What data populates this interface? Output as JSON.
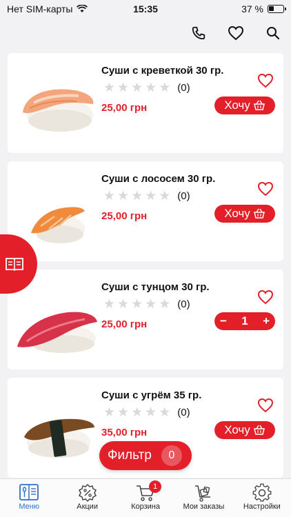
{
  "status_bar": {
    "carrier": "Нет SIM-карты",
    "time": "15:35",
    "battery_text": "37 %",
    "battery_level": 0.37
  },
  "header": {
    "icons": [
      "phone-icon",
      "heart-icon",
      "search-icon"
    ]
  },
  "products": [
    {
      "title": "Суши с креветкой 30 гр.",
      "rating_count": "(0)",
      "price": "25,00 грн",
      "button_label": "Хочу",
      "in_cart": false
    },
    {
      "title": "Суши с лососем 30 гр.",
      "rating_count": "(0)",
      "price": "25,00 грн",
      "button_label": "Хочу",
      "in_cart": false
    },
    {
      "title": "Суши с тунцом 30 гр.",
      "rating_count": "(0)",
      "price": "25,00 грн",
      "quantity": "1",
      "in_cart": true
    },
    {
      "title": "Суши с угрём 35 гр.",
      "rating_count": "(0)",
      "price": "35,00 грн",
      "button_label": "Хочу",
      "in_cart": false
    }
  ],
  "filter": {
    "label": "Фильтр",
    "count": "0"
  },
  "tabs": [
    {
      "label": "Меню",
      "icon": "menu-icon",
      "active": true
    },
    {
      "label": "Акции",
      "icon": "discount-icon",
      "active": false
    },
    {
      "label": "Корзина",
      "icon": "cart-icon",
      "active": false,
      "badge": "1"
    },
    {
      "label": "Мои заказы",
      "icon": "orders-icon",
      "active": false
    },
    {
      "label": "Настройки",
      "icon": "settings-icon",
      "active": false
    }
  ],
  "colors": {
    "accent": "#e3202a",
    "active_tab": "#2c6fc7"
  }
}
